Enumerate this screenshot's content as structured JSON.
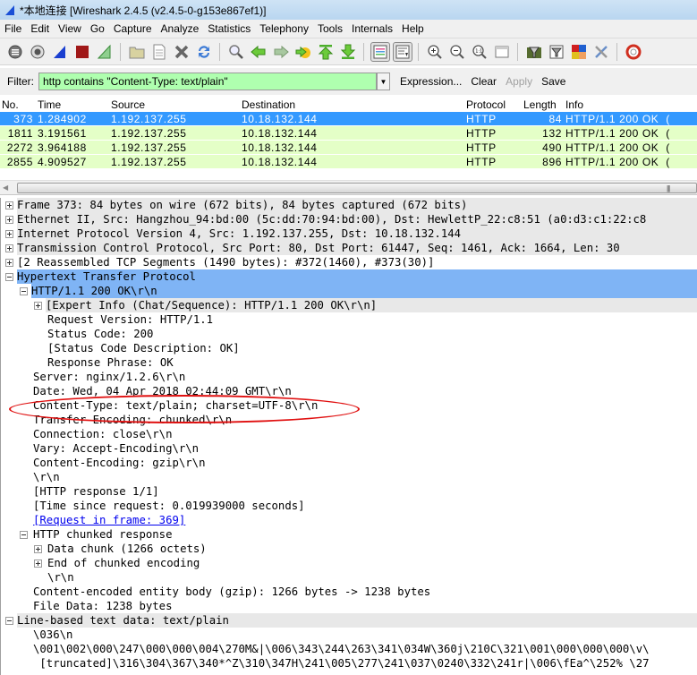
{
  "window": {
    "title": "*本地连接 [Wireshark 2.4.5 (v2.4.5-0-g153e867ef1)]"
  },
  "menu": [
    "File",
    "Edit",
    "View",
    "Go",
    "Capture",
    "Analyze",
    "Statistics",
    "Telephony",
    "Tools",
    "Internals",
    "Help"
  ],
  "toolbar": {
    "icons": [
      "interfaces-icon",
      "capture-options-icon",
      "start-capture-icon",
      "stop-capture-icon",
      "restart-capture-icon",
      "open-file-icon",
      "save-file-icon",
      "close-file-icon",
      "reload-icon",
      "find-packet-icon",
      "go-back-icon",
      "go-forward-icon",
      "go-to-packet-icon",
      "go-first-icon",
      "go-last-icon",
      "colorize-icon",
      "auto-scroll-icon",
      "zoom-in-icon",
      "zoom-out-icon",
      "zoom-normal-icon",
      "resize-columns-icon",
      "capture-filters-icon",
      "display-filters-icon",
      "coloring-rules-icon",
      "preferences-icon",
      "help-icon"
    ]
  },
  "filter": {
    "label": "Filter:",
    "value": "http contains \"Content-Type: text/plain\"",
    "expression_label": "Expression...",
    "clear_label": "Clear",
    "apply_label": "Apply",
    "save_label": "Save",
    "valid_color": "#afffaf"
  },
  "packet_list": {
    "columns": [
      "No.",
      "Time",
      "Source",
      "Destination",
      "Protocol",
      "Length",
      "Info"
    ],
    "rows": [
      {
        "no": "373",
        "time": "1.284902",
        "src": "1.192.137.255",
        "dst": "10.18.132.144",
        "proto": "HTTP",
        "len": "84",
        "info": "HTTP/1.1 200 OK  (",
        "selected": true
      },
      {
        "no": "1811",
        "time": "3.191561",
        "src": "1.192.137.255",
        "dst": "10.18.132.144",
        "proto": "HTTP",
        "len": "132",
        "info": "HTTP/1.1 200 OK  (",
        "selected": false
      },
      {
        "no": "2272",
        "time": "3.964188",
        "src": "1.192.137.255",
        "dst": "10.18.132.144",
        "proto": "HTTP",
        "len": "490",
        "info": "HTTP/1.1 200 OK  (",
        "selected": false
      },
      {
        "no": "2855",
        "time": "4.909527",
        "src": "1.192.137.255",
        "dst": "10.18.132.144",
        "proto": "HTTP",
        "len": "896",
        "info": "HTTP/1.1 200 OK  (",
        "selected": false
      }
    ],
    "row_color": "#e4ffc7",
    "selected_color": "#3399ff"
  },
  "details": {
    "frame": "Frame 373: 84 bytes on wire (672 bits), 84 bytes captured (672 bits)",
    "ethernet": "Ethernet II, Src: Hangzhou_94:bd:00 (5c:dd:70:94:bd:00), Dst: HewlettP_22:c8:51 (a0:d3:c1:22:c8",
    "ip": "Internet Protocol Version 4, Src: 1.192.137.255, Dst: 10.18.132.144",
    "tcp": "Transmission Control Protocol, Src Port: 80, Dst Port: 61447, Seq: 1461, Ack: 1664, Len: 30",
    "reassembled": "[2 Reassembled TCP Segments (1490 bytes): #372(1460), #373(30)]",
    "http": "Hypertext Transfer Protocol",
    "status_line": "HTTP/1.1 200 OK\\r\\n",
    "expert_info": "[Expert Info (Chat/Sequence): HTTP/1.1 200 OK\\r\\n]",
    "request_version": "Request Version: HTTP/1.1",
    "status_code": "Status Code: 200",
    "status_desc": "[Status Code Description: OK]",
    "response_phrase": "Response Phrase: OK",
    "server": "Server: nginx/1.2.6\\r\\n",
    "date": "Date: Wed, 04 Apr 2018 02:44:09 GMT\\r\\n",
    "content_type": "Content-Type: text/plain; charset=UTF-8\\r\\n",
    "transfer_encoding": "Transfer-Encoding: chunked\\r\\n",
    "connection": "Connection: close\\r\\n",
    "vary": "Vary: Accept-Encoding\\r\\n",
    "content_encoding": "Content-Encoding: gzip\\r\\n",
    "crlf": "\\r\\n",
    "http_response": "[HTTP response 1/1]",
    "time_since": "[Time since request: 0.019939000 seconds]",
    "request_in_frame": "[Request in frame: 369]",
    "chunked": "HTTP chunked response",
    "data_chunk": "Data chunk (1266 octets)",
    "end_chunk": "End of chunked encoding",
    "chunk_crlf": "\\r\\n",
    "entity_body": "Content-encoded entity body (gzip): 1266 bytes -> 1238 bytes",
    "file_data": "File Data: 1238 bytes",
    "line_based": "Line-based text data: text/plain",
    "line1": "\\036\\n",
    "line2": "\\001\\002\\000\\247\\000\\000\\004\\270M&|\\006\\343\\244\\263\\341\\034W\\360j\\210C\\321\\001\\000\\000\\000\\v\\",
    "line3": " [truncated]\\316\\304\\367\\340*^Z\\310\\347H\\241\\005\\277\\241\\037\\0240\\332\\241r|\\006\\fEa^\\252% \\27"
  }
}
